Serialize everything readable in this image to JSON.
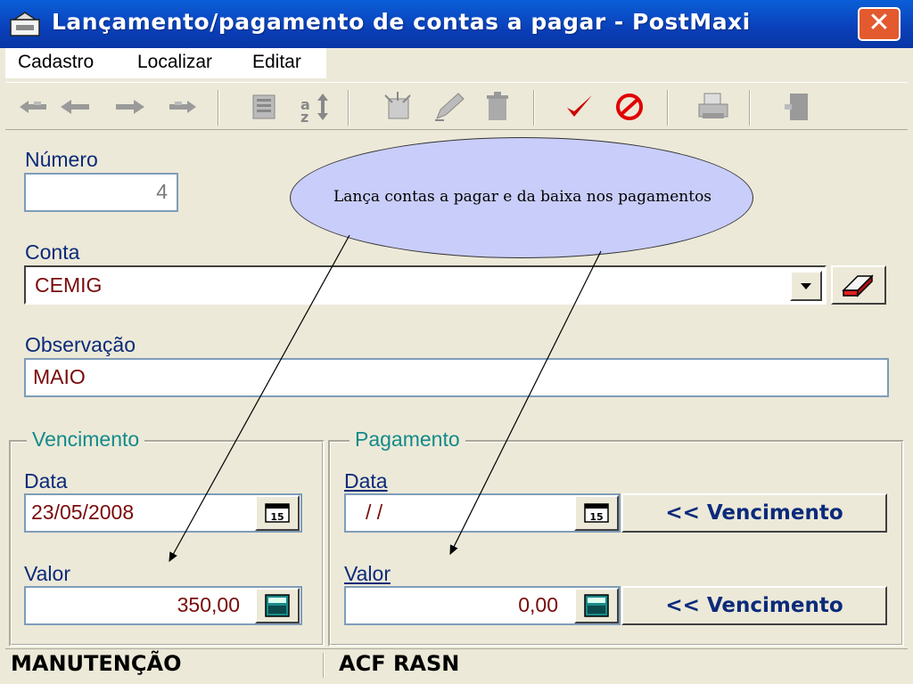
{
  "window": {
    "title": "Lançamento/pagamento de contas a pagar - PostMaxi",
    "close_symbol": "✕"
  },
  "menu": {
    "items": [
      "Cadastro",
      "Localizar",
      "Editar"
    ]
  },
  "toolbar": {
    "icons": [
      "first-record-icon",
      "previous-record-icon",
      "next-record-icon",
      "last-record-icon",
      "find-icon",
      "sort-icon",
      "new-icon",
      "edit-icon",
      "delete-icon",
      "confirm-icon",
      "cancel-icon",
      "print-icon",
      "exit-icon"
    ]
  },
  "form": {
    "numero": {
      "label": "Número",
      "value": "4"
    },
    "conta": {
      "label": "Conta",
      "value": "CEMIG"
    },
    "observacao": {
      "label": "Observação",
      "value": "MAIO"
    }
  },
  "vencimento": {
    "title": "Vencimento",
    "data_label": "Data",
    "data_value": "23/05/2008",
    "valor_label": "Valor",
    "valor_value": "350,00"
  },
  "pagamento": {
    "title": "Pagamento",
    "data_label": "Data",
    "data_value": " /  /",
    "valor_label": "Valor",
    "valor_value": "0,00",
    "copy_date_button": "<< Vencimento",
    "copy_value_button": "<< Vencimento"
  },
  "status": {
    "mode": "MANUTENÇÃO",
    "flags": "ACF RASN"
  },
  "callout": {
    "text": "Lança contas a pagar e da baixa nos pagamentos"
  },
  "colors": {
    "title_bar": "#0a4fc8",
    "accent_label": "#0b2a7a",
    "group_title": "#138a8a",
    "field_text": "#7a0a0a",
    "callout_fill": "#c9cdfa",
    "confirm": "#cc0000"
  }
}
